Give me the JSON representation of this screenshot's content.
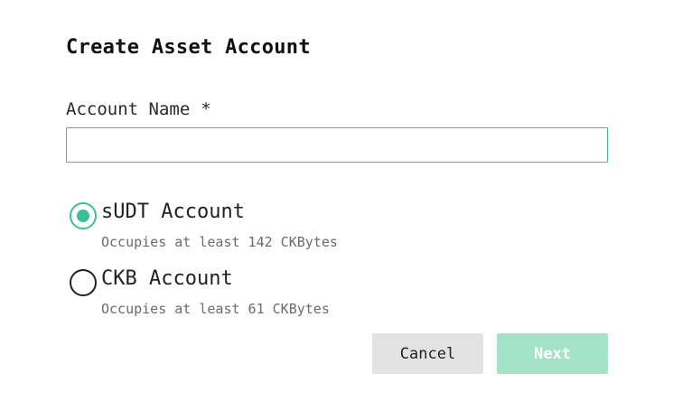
{
  "dialog": {
    "title": "Create Asset Account",
    "account_name": {
      "label": "Account Name",
      "required_marker": "*",
      "value": "",
      "placeholder": ""
    },
    "options": [
      {
        "label": "sUDT Account",
        "description": "Occupies at least 142 CKBytes",
        "selected": true
      },
      {
        "label": "CKB Account",
        "description": "Occupies at least 61 CKBytes",
        "selected": false
      }
    ],
    "buttons": {
      "cancel": "Cancel",
      "next": "Next"
    },
    "colors": {
      "accent": "#3cc08e",
      "next_disabled_bg": "#a3e4c8",
      "cancel_bg": "#e3e3e3"
    }
  }
}
